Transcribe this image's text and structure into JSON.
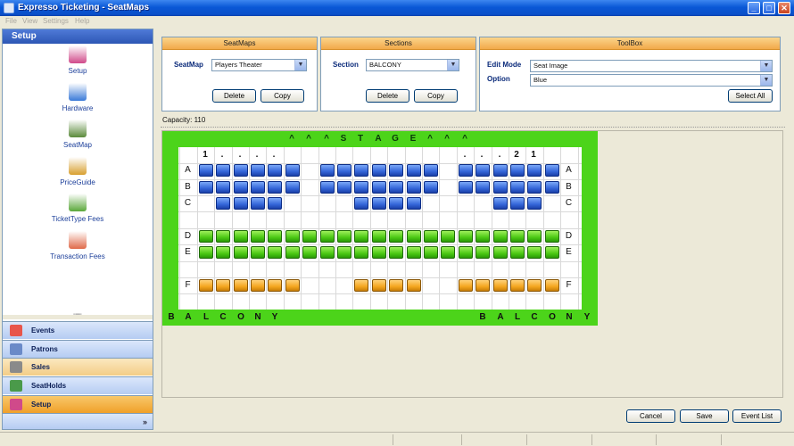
{
  "window": {
    "title": "Expresso Ticketing - SeatMaps",
    "minimize": "_",
    "maximize": "□",
    "close": "✕"
  },
  "menu": [
    "File",
    "View",
    "Settings",
    "Help"
  ],
  "sidebar": {
    "header": "Setup",
    "items": [
      {
        "label": "Setup",
        "icon": "toolbox-icon",
        "color": "#d04a8a"
      },
      {
        "label": "Hardware",
        "icon": "computer-icon",
        "color": "#3a7ad8"
      },
      {
        "label": "SeatMap",
        "icon": "seatmap-icon",
        "color": "#5a8a3a"
      },
      {
        "label": "PriceGuide",
        "icon": "price-guide-icon",
        "color": "#d8a030"
      },
      {
        "label": "TicketType Fees",
        "icon": "ticket-icon",
        "color": "#5aa83a"
      },
      {
        "label": "Transaction Fees",
        "icon": "transaction-icon",
        "color": "#e06a4a"
      }
    ],
    "grip": "''''''''",
    "bar": [
      {
        "label": "Events",
        "icon": "calendar-icon",
        "color": "#e8554a"
      },
      {
        "label": "Patrons",
        "icon": "patrons-icon",
        "color": "#6a8ac8"
      },
      {
        "label": "Sales",
        "icon": "sales-icon",
        "color": "#8a8a8a"
      },
      {
        "label": "SeatHolds",
        "icon": "seatholds-icon",
        "color": "#4a9a4a"
      },
      {
        "label": "Setup",
        "icon": "setup-icon",
        "color": "#d04a8a"
      }
    ],
    "more": "»"
  },
  "seatmaps_panel": {
    "title": "SeatMaps",
    "label": "SeatMap",
    "value": "Players Theater",
    "delete": "Delete",
    "copy": "Copy"
  },
  "sections_panel": {
    "title": "Sections",
    "label": "Section",
    "value": "BALCONY",
    "delete": "Delete",
    "copy": "Copy"
  },
  "toolbox_panel": {
    "title": "ToolBox",
    "edit_mode_label": "Edit Mode",
    "edit_mode_value": "Seat Image",
    "option_label": "Option",
    "option_value": "Blue",
    "select_all": "Select All"
  },
  "capacity": "Capacity: 110",
  "seatmap": {
    "stage_text": [
      "^",
      "^",
      "^",
      "S",
      "T",
      "A",
      "G",
      "E",
      "^",
      "^",
      "^"
    ],
    "seat_numbers_left": [
      "1",
      ".",
      ".",
      ".",
      "."
    ],
    "seat_numbers_right": [
      ".",
      ".",
      ".",
      "2",
      "1"
    ],
    "row_labels": [
      "A",
      "B",
      "C",
      "D",
      "E",
      "F"
    ],
    "balcony_left": [
      "B",
      "A",
      "L",
      "C",
      "O",
      "N",
      "Y"
    ],
    "balcony_right": [
      "B",
      "A",
      "L",
      "C",
      "O",
      "N",
      "Y"
    ],
    "colors": {
      "blue": "#3465d8",
      "green": "#4bc814",
      "orange": "#f4a620",
      "background": "#4cd41a"
    },
    "rows": [
      {
        "label": "A",
        "color": "blue",
        "cols": [
          1,
          2,
          3,
          4,
          5,
          6,
          8,
          9,
          10,
          11,
          12,
          13,
          14,
          16,
          17,
          18,
          19,
          20,
          21
        ]
      },
      {
        "label": "B",
        "color": "blue",
        "cols": [
          1,
          2,
          3,
          4,
          5,
          6,
          8,
          9,
          10,
          11,
          12,
          13,
          14,
          16,
          17,
          18,
          19,
          20,
          21
        ]
      },
      {
        "label": "C",
        "color": "blue",
        "cols": [
          2,
          3,
          4,
          5,
          10,
          11,
          12,
          13,
          18,
          19,
          20
        ]
      },
      {
        "label": "D",
        "color": "green",
        "cols": [
          1,
          2,
          3,
          4,
          5,
          6,
          7,
          8,
          9,
          10,
          11,
          12,
          13,
          14,
          15,
          16,
          17,
          18,
          19,
          20,
          21
        ]
      },
      {
        "label": "E",
        "color": "green",
        "cols": [
          1,
          2,
          3,
          4,
          5,
          6,
          7,
          8,
          9,
          10,
          11,
          12,
          13,
          14,
          15,
          16,
          17,
          18,
          19,
          20,
          21
        ]
      },
      {
        "label": "F",
        "color": "orange",
        "cols": [
          1,
          2,
          3,
          4,
          5,
          6,
          10,
          11,
          12,
          13,
          16,
          17,
          18,
          19,
          20,
          21
        ]
      }
    ]
  },
  "footer": {
    "cancel": "Cancel",
    "save": "Save",
    "event_list": "Event List"
  }
}
